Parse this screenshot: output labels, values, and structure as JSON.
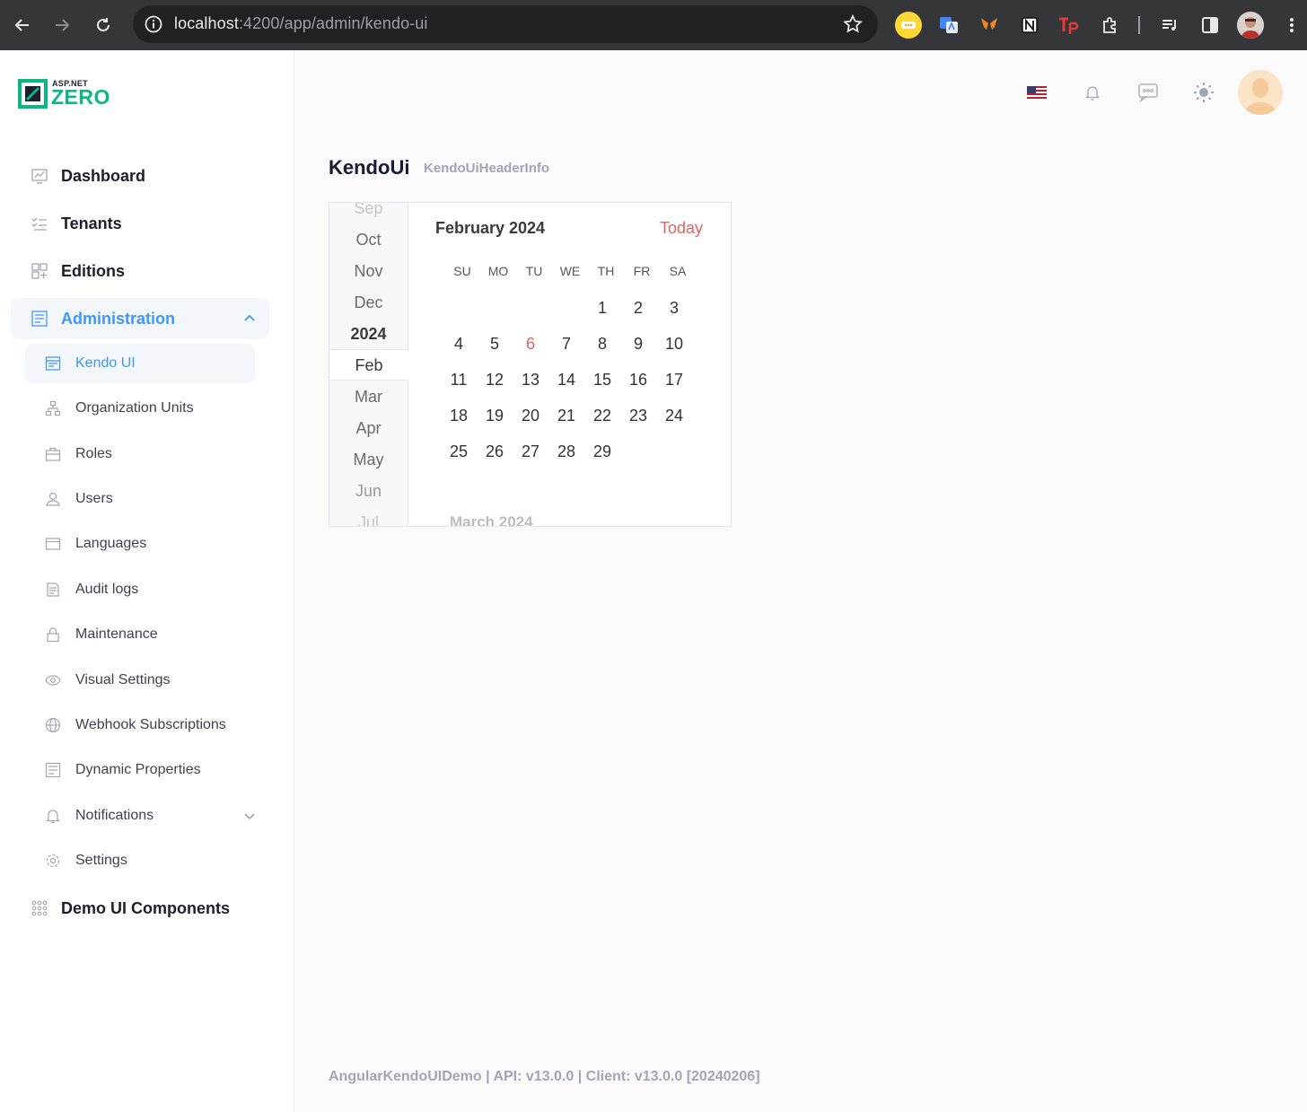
{
  "browser": {
    "url_host": "localhost",
    "url_path": ":4200/app/admin/kendo-ui"
  },
  "brand": {
    "small": "ASP.NET",
    "big": "ZERO"
  },
  "sidebar": {
    "top_items": [
      {
        "label": "Dashboard"
      },
      {
        "label": "Tenants"
      },
      {
        "label": "Editions"
      },
      {
        "label": "Administration"
      }
    ],
    "sub_items": [
      {
        "label": "Kendo UI"
      },
      {
        "label": "Organization Units"
      },
      {
        "label": "Roles"
      },
      {
        "label": "Users"
      },
      {
        "label": "Languages"
      },
      {
        "label": "Audit logs"
      },
      {
        "label": "Maintenance"
      },
      {
        "label": "Visual Settings"
      },
      {
        "label": "Webhook Subscriptions"
      },
      {
        "label": "Dynamic Properties"
      },
      {
        "label": "Notifications"
      },
      {
        "label": "Settings"
      }
    ],
    "bottom_item": {
      "label": "Demo UI Components"
    }
  },
  "page": {
    "title": "KendoUi",
    "subtitle": "KendoUiHeaderInfo"
  },
  "calendar": {
    "nav": [
      "Sep",
      "Oct",
      "Nov",
      "Dec",
      "2024",
      "Feb",
      "Mar",
      "Apr",
      "May",
      "Jun",
      "Jul"
    ],
    "title": "February 2024",
    "today_label": "Today",
    "weekdays": [
      "SU",
      "MO",
      "TU",
      "WE",
      "TH",
      "FR",
      "SA"
    ],
    "weeks": [
      [
        "",
        "",
        "",
        "",
        "1",
        "2",
        "3"
      ],
      [
        "4",
        "5",
        "6",
        "7",
        "8",
        "9",
        "10"
      ],
      [
        "11",
        "12",
        "13",
        "14",
        "15",
        "16",
        "17"
      ],
      [
        "18",
        "19",
        "20",
        "21",
        "22",
        "23",
        "24"
      ],
      [
        "25",
        "26",
        "27",
        "28",
        "29",
        "",
        ""
      ]
    ],
    "today_day": "6",
    "next_month_label": "March 2024"
  },
  "footer": {
    "text": "AngularKendoUIDemo | API: v13.0.0 | Client: v13.0.0 [20240206]"
  },
  "colors": {
    "accent": "#3e97ff",
    "today": "#e86060",
    "brand_green": "#0bb783"
  }
}
